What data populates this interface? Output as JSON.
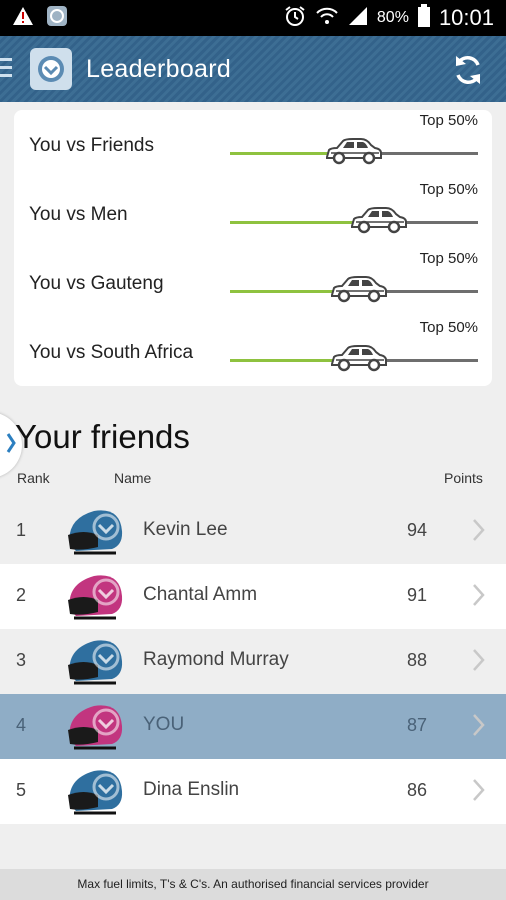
{
  "status_bar": {
    "battery": "80%",
    "time": "10:01",
    "icons": [
      "warning-icon",
      "app-notification-icon",
      "alarm-icon",
      "wifi-icon",
      "signal-icon",
      "battery-icon"
    ]
  },
  "app_bar": {
    "title": "Leaderboard",
    "icons": [
      "menu-icon",
      "logo-icon",
      "refresh-icon"
    ]
  },
  "comparisons": [
    {
      "label": "You vs Friends",
      "rank_text": "Top 50%",
      "progress": 0.44
    },
    {
      "label": "You vs Men",
      "rank_text": "Top 50%",
      "progress": 0.54
    },
    {
      "label": "You vs Gauteng",
      "rank_text": "Top 50%",
      "progress": 0.46
    },
    {
      "label": "You vs South Africa",
      "rank_text": "Top 50%",
      "progress": 0.46
    }
  ],
  "friends": {
    "title": "Your friends",
    "columns": {
      "rank": "Rank",
      "name": "Name",
      "points": "Points"
    },
    "rows": [
      {
        "rank": "1",
        "name": "Kevin Lee",
        "points": "94",
        "helmet_color": "#2f6f9f"
      },
      {
        "rank": "2",
        "name": "Chantal Amm",
        "points": "91",
        "helmet_color": "#c2357f"
      },
      {
        "rank": "3",
        "name": "Raymond Murray",
        "points": "88",
        "helmet_color": "#2f6f9f"
      },
      {
        "rank": "4",
        "name": "YOU",
        "points": "87",
        "helmet_color": "#c2357f",
        "highlight": true
      },
      {
        "rank": "5",
        "name": "Dina Enslin",
        "points": "86",
        "helmet_color": "#2f6f9f"
      }
    ]
  },
  "footer": {
    "text": "Max fuel limits, T's & C's. An authorised financial services provider"
  },
  "colors": {
    "app_bar": "#3a6a90",
    "progress_fill": "#8ec23f",
    "highlight_row": "#8fadc6"
  }
}
